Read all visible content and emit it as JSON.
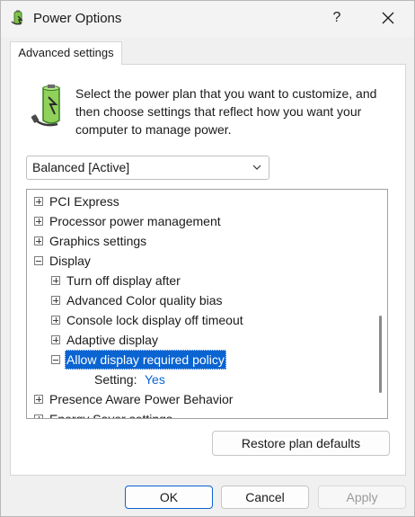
{
  "window": {
    "title": "Power Options",
    "help_label": "?"
  },
  "tabs": [
    {
      "label": "Advanced settings"
    }
  ],
  "description": "Select the power plan that you want to customize, and then choose settings that reflect how you want your computer to manage power.",
  "plan_select": {
    "value": "Balanced [Active]"
  },
  "tree": {
    "items": [
      {
        "label": "PCI Express",
        "state": "collapsed"
      },
      {
        "label": "Processor power management",
        "state": "collapsed"
      },
      {
        "label": "Graphics settings",
        "state": "collapsed"
      },
      {
        "label": "Display",
        "state": "expanded"
      },
      {
        "label": "Turn off display after",
        "state": "collapsed"
      },
      {
        "label": "Advanced Color quality bias",
        "state": "collapsed"
      },
      {
        "label": "Console lock display off timeout",
        "state": "collapsed"
      },
      {
        "label": "Adaptive display",
        "state": "collapsed"
      },
      {
        "label": "Allow display required policy",
        "state": "expanded",
        "selected": true
      },
      {
        "label": "Setting:",
        "value": "Yes"
      },
      {
        "label": "Presence Aware Power Behavior",
        "state": "collapsed"
      },
      {
        "label": "Energy Saver settings",
        "state": "collapsed"
      }
    ]
  },
  "buttons": {
    "restore": "Restore plan defaults",
    "ok": "OK",
    "cancel": "Cancel",
    "apply": "Apply"
  },
  "colors": {
    "accent": "#0a64d2",
    "selection_bg": "#0a64d2",
    "disabled_text": "#9a9a9a"
  }
}
